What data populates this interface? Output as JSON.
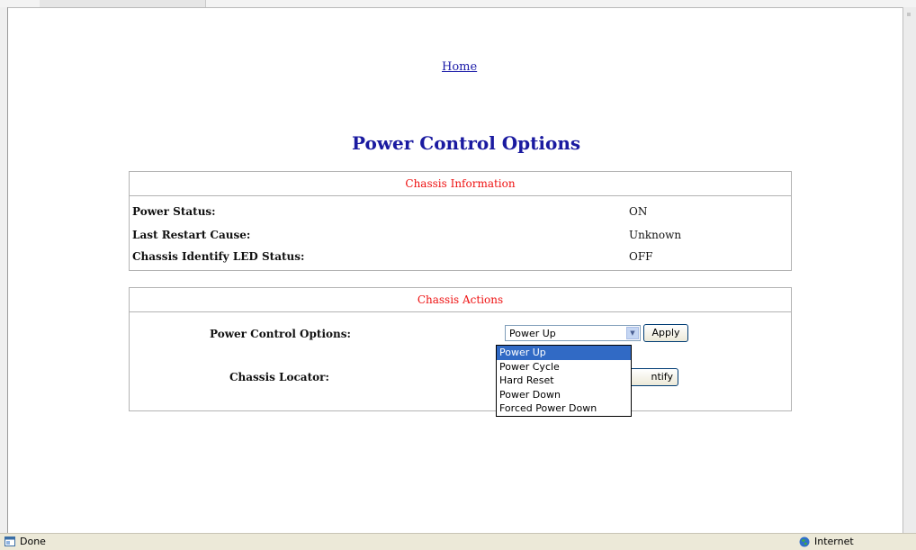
{
  "nav": {
    "home_label": "Home"
  },
  "page": {
    "title": "Power Control Options"
  },
  "chassis_info": {
    "header": "Chassis Information",
    "rows": [
      {
        "label": "Power Status:",
        "value": "ON"
      },
      {
        "label": "Last Restart Cause:",
        "value": "Unknown"
      },
      {
        "label": "Chassis Identify LED Status:",
        "value": "OFF"
      }
    ]
  },
  "chassis_actions": {
    "header": "Chassis Actions",
    "power_control_label": "Power Control Options:",
    "power_select_value": "Power Up",
    "apply_label": "Apply",
    "locator_label": "Chassis Locator:",
    "identify_label": "ntify",
    "dropdown_options": [
      "Power Up",
      "Power Cycle",
      "Hard Reset",
      "Power Down",
      "Forced Power Down"
    ],
    "dropdown_highlighted": "Power Up"
  },
  "status_bar": {
    "left_text": "Done",
    "right_text": "Internet",
    "left_icon": "page-done-icon",
    "right_icon": "internet-globe-icon"
  }
}
